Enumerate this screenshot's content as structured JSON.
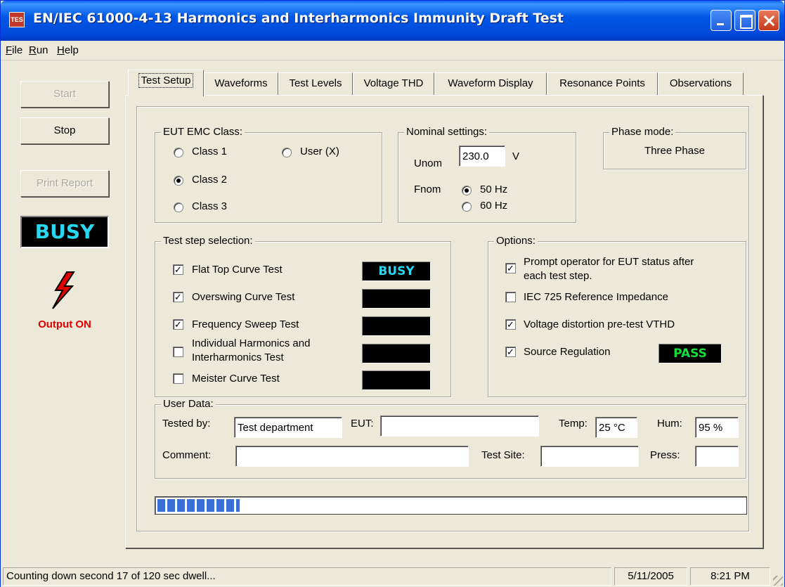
{
  "window": {
    "title": "EN/IEC 61000-4-13 Harmonics and Interharmonics Immunity Draft Test",
    "icon": "app-icon"
  },
  "menu": {
    "items": [
      "File",
      "Run",
      "Help"
    ]
  },
  "sidebar": {
    "start_label": "Start",
    "stop_label": "Stop",
    "print_report_label": "Print Report",
    "busy_label": "BUSY",
    "output_icon": "lightning-bolt-icon",
    "output_label": "Output ON",
    "busy_color": "#27d8f0",
    "output_color": "#e00000"
  },
  "tabs": [
    {
      "label": "Test Setup",
      "active": true
    },
    {
      "label": "Waveforms"
    },
    {
      "label": "Test Levels"
    },
    {
      "label": "Voltage THD"
    },
    {
      "label": "Waveform Display"
    },
    {
      "label": "Resonance Points"
    },
    {
      "label": "Observations"
    }
  ],
  "eut_class": {
    "title": "EUT EMC Class:",
    "options": [
      "Class 1",
      "Class 2",
      "Class 3",
      "User (X)"
    ],
    "selected": "Class 2"
  },
  "nominal": {
    "title": "Nominal settings:",
    "unom_label": "Unom",
    "unom_value": "230.0",
    "unom_unit": "V",
    "fnom_label": "Fnom",
    "fnom_options": [
      "50 Hz",
      "60 Hz"
    ],
    "fnom_selected": "50 Hz"
  },
  "phase": {
    "title": "Phase mode:",
    "value": "Three Phase"
  },
  "test_steps": {
    "title": "Test step selection:",
    "items": [
      {
        "label": "Flat Top Curve Test",
        "checked": true,
        "status": "BUSY"
      },
      {
        "label": "Overswing Curve Test",
        "checked": true,
        "status": ""
      },
      {
        "label": "Frequency Sweep Test",
        "checked": true,
        "status": ""
      },
      {
        "label": "Individual Harmonics and Interharmonics Test",
        "line1": "Individual Harmonics and",
        "line2": "Interharmonics Test",
        "checked": false,
        "status": ""
      },
      {
        "label": "Meister Curve Test",
        "checked": false,
        "status": ""
      }
    ]
  },
  "options": {
    "title": "Options:",
    "items": [
      {
        "label": "Prompt operator for EUT status after each test step.",
        "line1": "Prompt operator for EUT status after",
        "line2": "each test step.",
        "checked": true
      },
      {
        "label": "IEC 725 Reference Impedance",
        "checked": false
      },
      {
        "label": "Voltage distortion pre-test VTHD",
        "checked": true
      },
      {
        "label": "Source Regulation",
        "checked": true,
        "status": "PASS"
      }
    ],
    "pass_color": "#15e03a"
  },
  "user_data": {
    "title": "User Data:",
    "tested_by_label": "Tested by:",
    "tested_by_value": "Test department",
    "eut_label": "EUT:",
    "eut_value": "",
    "temp_label": "Temp:",
    "temp_value": "25 °C",
    "hum_label": "Hum:",
    "hum_value": "95 %",
    "comment_label": "Comment:",
    "comment_value": "",
    "test_site_label": "Test Site:",
    "test_site_value": "",
    "press_label": "Press:",
    "press_value": ""
  },
  "progress": {
    "fraction": 0.14
  },
  "status": {
    "message": "Counting down second 17 of 120 sec dwell...",
    "date": "5/11/2005",
    "time": "8:21 PM"
  }
}
